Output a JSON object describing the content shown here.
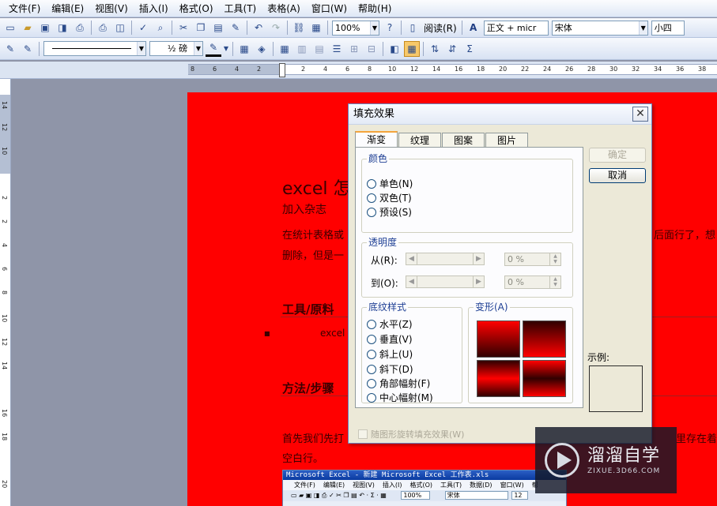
{
  "menubar": {
    "items": [
      "文件(F)",
      "编辑(E)",
      "视图(V)",
      "插入(I)",
      "格式(O)",
      "工具(T)",
      "表格(A)",
      "窗口(W)",
      "帮助(H)"
    ]
  },
  "toolbar1": {
    "zoom": "100%",
    "read_label": "阅读(R)",
    "style": "正文 + micr",
    "font": "宋体",
    "size": "小四"
  },
  "toolbar2": {
    "line_weight": "½ 磅"
  },
  "ruler_h": [
    "8",
    "6",
    "4",
    "2",
    "2",
    "4",
    "6",
    "8",
    "10",
    "12",
    "14",
    "16",
    "18",
    "20",
    "22",
    "24",
    "26",
    "28",
    "30",
    "32",
    "34",
    "36",
    "38"
  ],
  "ruler_v": [
    "14",
    "12",
    "10",
    "2",
    "2",
    "4",
    "6",
    "8",
    "10",
    "12",
    "14",
    "16",
    "18",
    "20"
  ],
  "document": {
    "title": "excel 怎",
    "subtitle": "加入杂志",
    "para1_line1": "在统计表格或",
    "para1_line1_tail": "后面行了，想",
    "para1_line2": "删除，但是一",
    "section_tools": "工具/原料",
    "tools_item": "excel",
    "section_steps": "方法/步骤",
    "step_line1": "首先我们先打",
    "step_line1_tail": "里存在着",
    "step_line2": "空白行。",
    "embedded_title": "Microsoft Excel - 新建 Microsoft Excel 工作表.xls",
    "embedded_menu": [
      "文件(F)",
      "编辑(E)",
      "视图(V)",
      "插入(I)",
      "格式(O)",
      "工具(T)",
      "数据(D)",
      "窗口(W)",
      "帮"
    ],
    "embedded_zoom": "100%",
    "embedded_font": "宋体",
    "embedded_size": "12"
  },
  "dialog": {
    "title": "填充效果",
    "tabs": [
      "渐变",
      "纹理",
      "图案",
      "图片"
    ],
    "colors_group": "颜色",
    "color_options": [
      "单色(N)",
      "双色(T)",
      "预设(S)"
    ],
    "transparency_group": "透明度",
    "from_label": "从(R):",
    "to_label": "到(O):",
    "from_value": "0 %",
    "to_value": "0 %",
    "shading_group": "底纹样式",
    "shading_options": [
      "水平(Z)",
      "垂直(V)",
      "斜上(U)",
      "斜下(D)",
      "角部幅射(F)",
      "中心幅射(M)"
    ],
    "variants_label": "变形(A)",
    "ok_label": "确定",
    "cancel_label": "取消",
    "sample_label": "示例:",
    "rotate_check": "随图形旋转填充效果(W)",
    "accent": "#ff0000"
  },
  "watermark": {
    "main": "溜溜自学",
    "sub": "ZIXUE.3D66.COM"
  }
}
